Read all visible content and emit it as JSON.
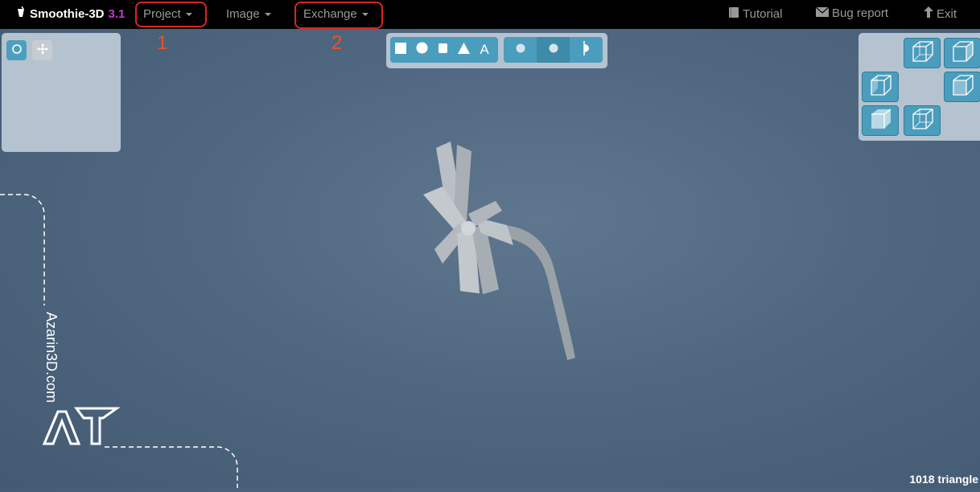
{
  "app": {
    "name": "Smoothie-3D",
    "version": "3.1"
  },
  "menu": {
    "project": "Project",
    "image": "Image",
    "exchange": "Exchange"
  },
  "links": {
    "tutorial": "Tutorial",
    "bug_report": "Bug report",
    "exit": "Exit"
  },
  "annotations": {
    "label1": "1",
    "label2": "2",
    "highlight_color": "#d8261f",
    "number_color": "#e8542a"
  },
  "left_panel": {
    "buttons": [
      "orbit-icon",
      "move-icon"
    ]
  },
  "shape_toolbar": {
    "shapes": [
      "square-icon",
      "circle-icon",
      "cylinder-icon",
      "cone-icon",
      "text-icon"
    ],
    "text_glyph": "A",
    "render_modes": [
      "flat-shading-icon",
      "smooth-shading-icon",
      "half-icon"
    ]
  },
  "view_cube": {
    "buttons": [
      "view-iso-front",
      "view-iso-right",
      "view-left",
      "view-right",
      "view-bottom",
      "view-iso-back"
    ]
  },
  "viewport": {
    "triangles": "1018 triangle"
  },
  "watermark": {
    "text": "Azarin3D.com"
  },
  "colors": {
    "accent": "#4b9dbd",
    "topbar": "#000000",
    "brand_version": "#c23bc9",
    "panel": "#b5c3d1"
  }
}
